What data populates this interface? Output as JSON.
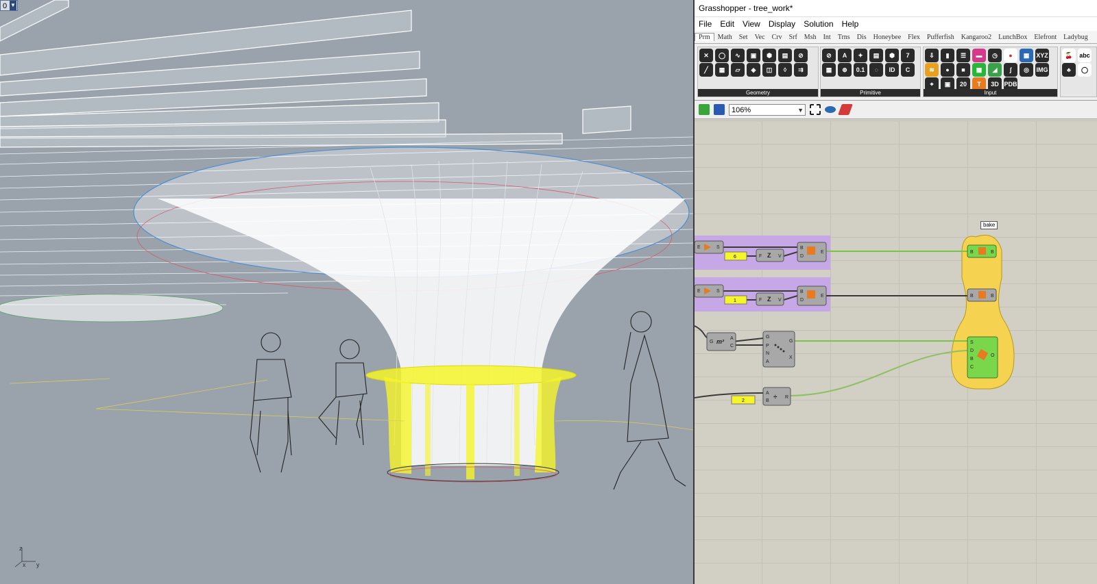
{
  "rhino": {
    "layer_value": "0",
    "axes": {
      "z": "z",
      "x": "x",
      "y": "y"
    }
  },
  "grasshopper": {
    "window_title": "Grasshopper - tree_work*",
    "menu": [
      "File",
      "Edit",
      "View",
      "Display",
      "Solution",
      "Help"
    ],
    "tabs": [
      "Prm",
      "Math",
      "Set",
      "Vec",
      "Crv",
      "Srf",
      "Msh",
      "Int",
      "Trns",
      "Dis",
      "Honeybee",
      "Flex",
      "Pufferfish",
      "Kangaroo2",
      "LunchBox",
      "Elefront",
      "Ladybug"
    ],
    "active_tab": "Prm",
    "ribbon_groups": [
      "Geometry",
      "Primitive",
      "Input"
    ],
    "toolbar": {
      "zoom": "106%"
    },
    "canvas": {
      "bake_label": "bake",
      "panel_values": [
        "6",
        "1",
        "2"
      ],
      "ports": {
        "vec_in": [
          "F",
          "Z",
          "V"
        ],
        "bake_B": "B",
        "bake_D": "D",
        "bake_E": "E",
        "srf": [
          "G",
          "m²",
          "A",
          "C"
        ],
        "pt": [
          "G",
          "P",
          "N",
          "A",
          "G",
          "X"
        ],
        "div": [
          "A",
          "B",
          "R"
        ],
        "cluster": [
          "S",
          "D",
          "B",
          "C",
          "O"
        ],
        "eye_io": [
          "E",
          "S"
        ]
      }
    }
  }
}
